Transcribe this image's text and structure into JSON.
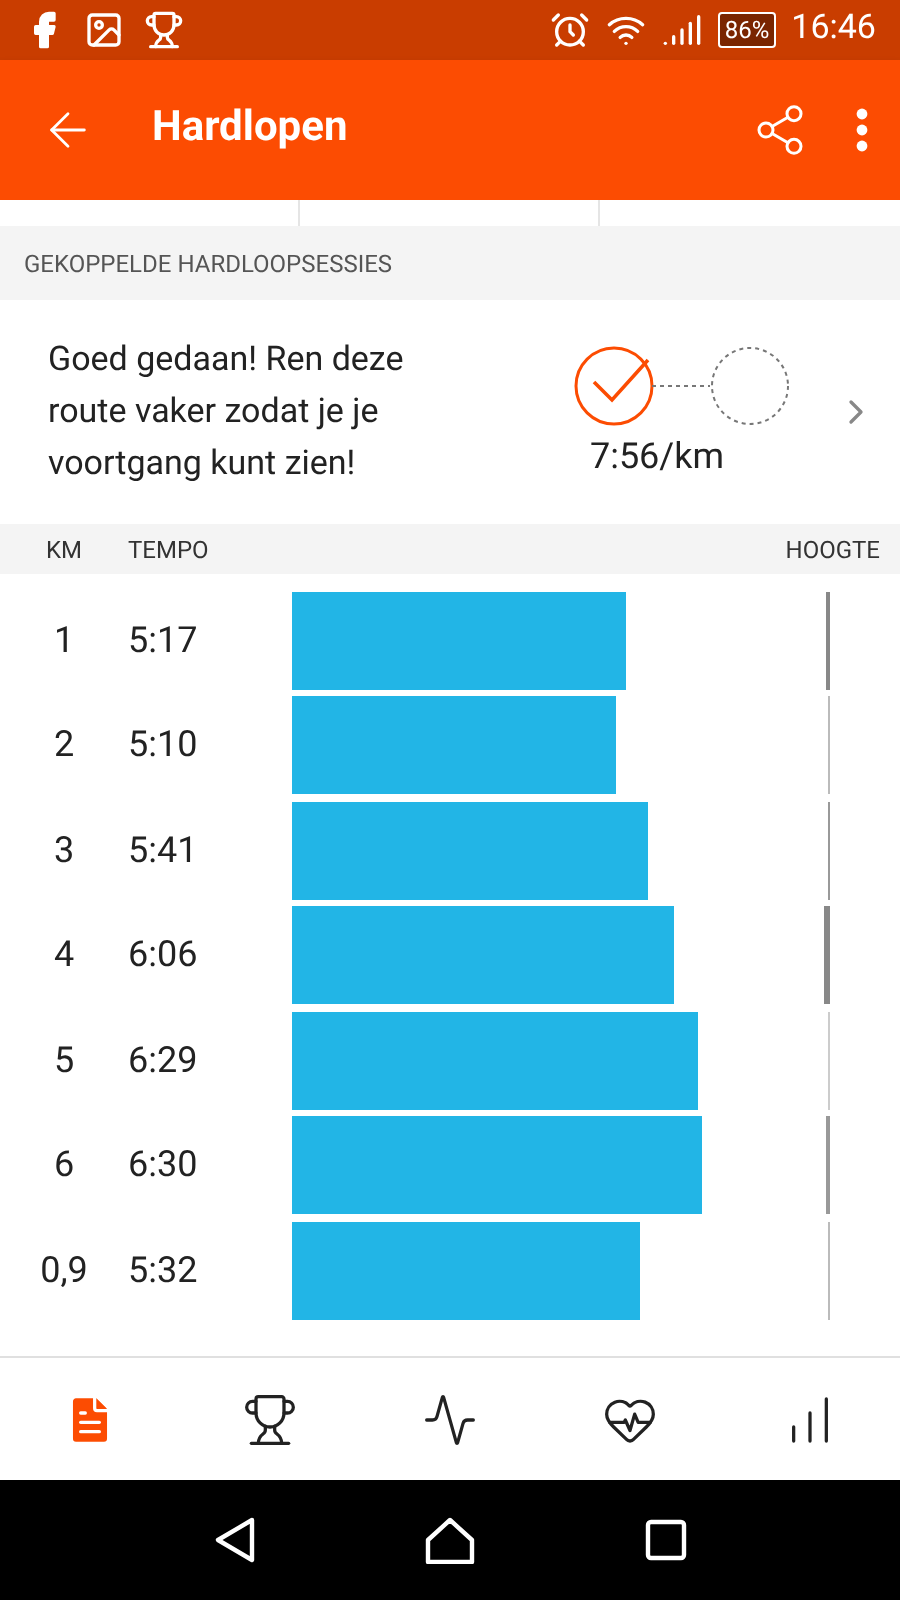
{
  "status_bar": {
    "battery": "86%",
    "time": "16:46"
  },
  "app_bar": {
    "title": "Hardlopen"
  },
  "section_header": "GEKOPPELDE HARDLOOPSESSIES",
  "linked_card": {
    "message": "Goed gedaan! Ren deze route vaker zodat je je voortgang kunt zien!",
    "pace": "7:56/km"
  },
  "splits": {
    "columns": [
      "KM",
      "TEMPO",
      "HOOGTE"
    ],
    "rows": [
      {
        "km": "1",
        "pace": "5:17"
      },
      {
        "km": "2",
        "pace": "5:10"
      },
      {
        "km": "3",
        "pace": "5:41"
      },
      {
        "km": "4",
        "pace": "6:06"
      },
      {
        "km": "5",
        "pace": "6:29"
      },
      {
        "km": "6",
        "pace": "6:30"
      },
      {
        "km": "0,9",
        "pace": "5:32"
      }
    ]
  },
  "bottom_nav": [
    {
      "kind": "overview",
      "selected": true
    },
    {
      "kind": "trophy",
      "selected": false
    },
    {
      "kind": "analysis",
      "selected": false
    },
    {
      "kind": "heart",
      "selected": false
    },
    {
      "kind": "stats",
      "selected": false
    }
  ]
}
